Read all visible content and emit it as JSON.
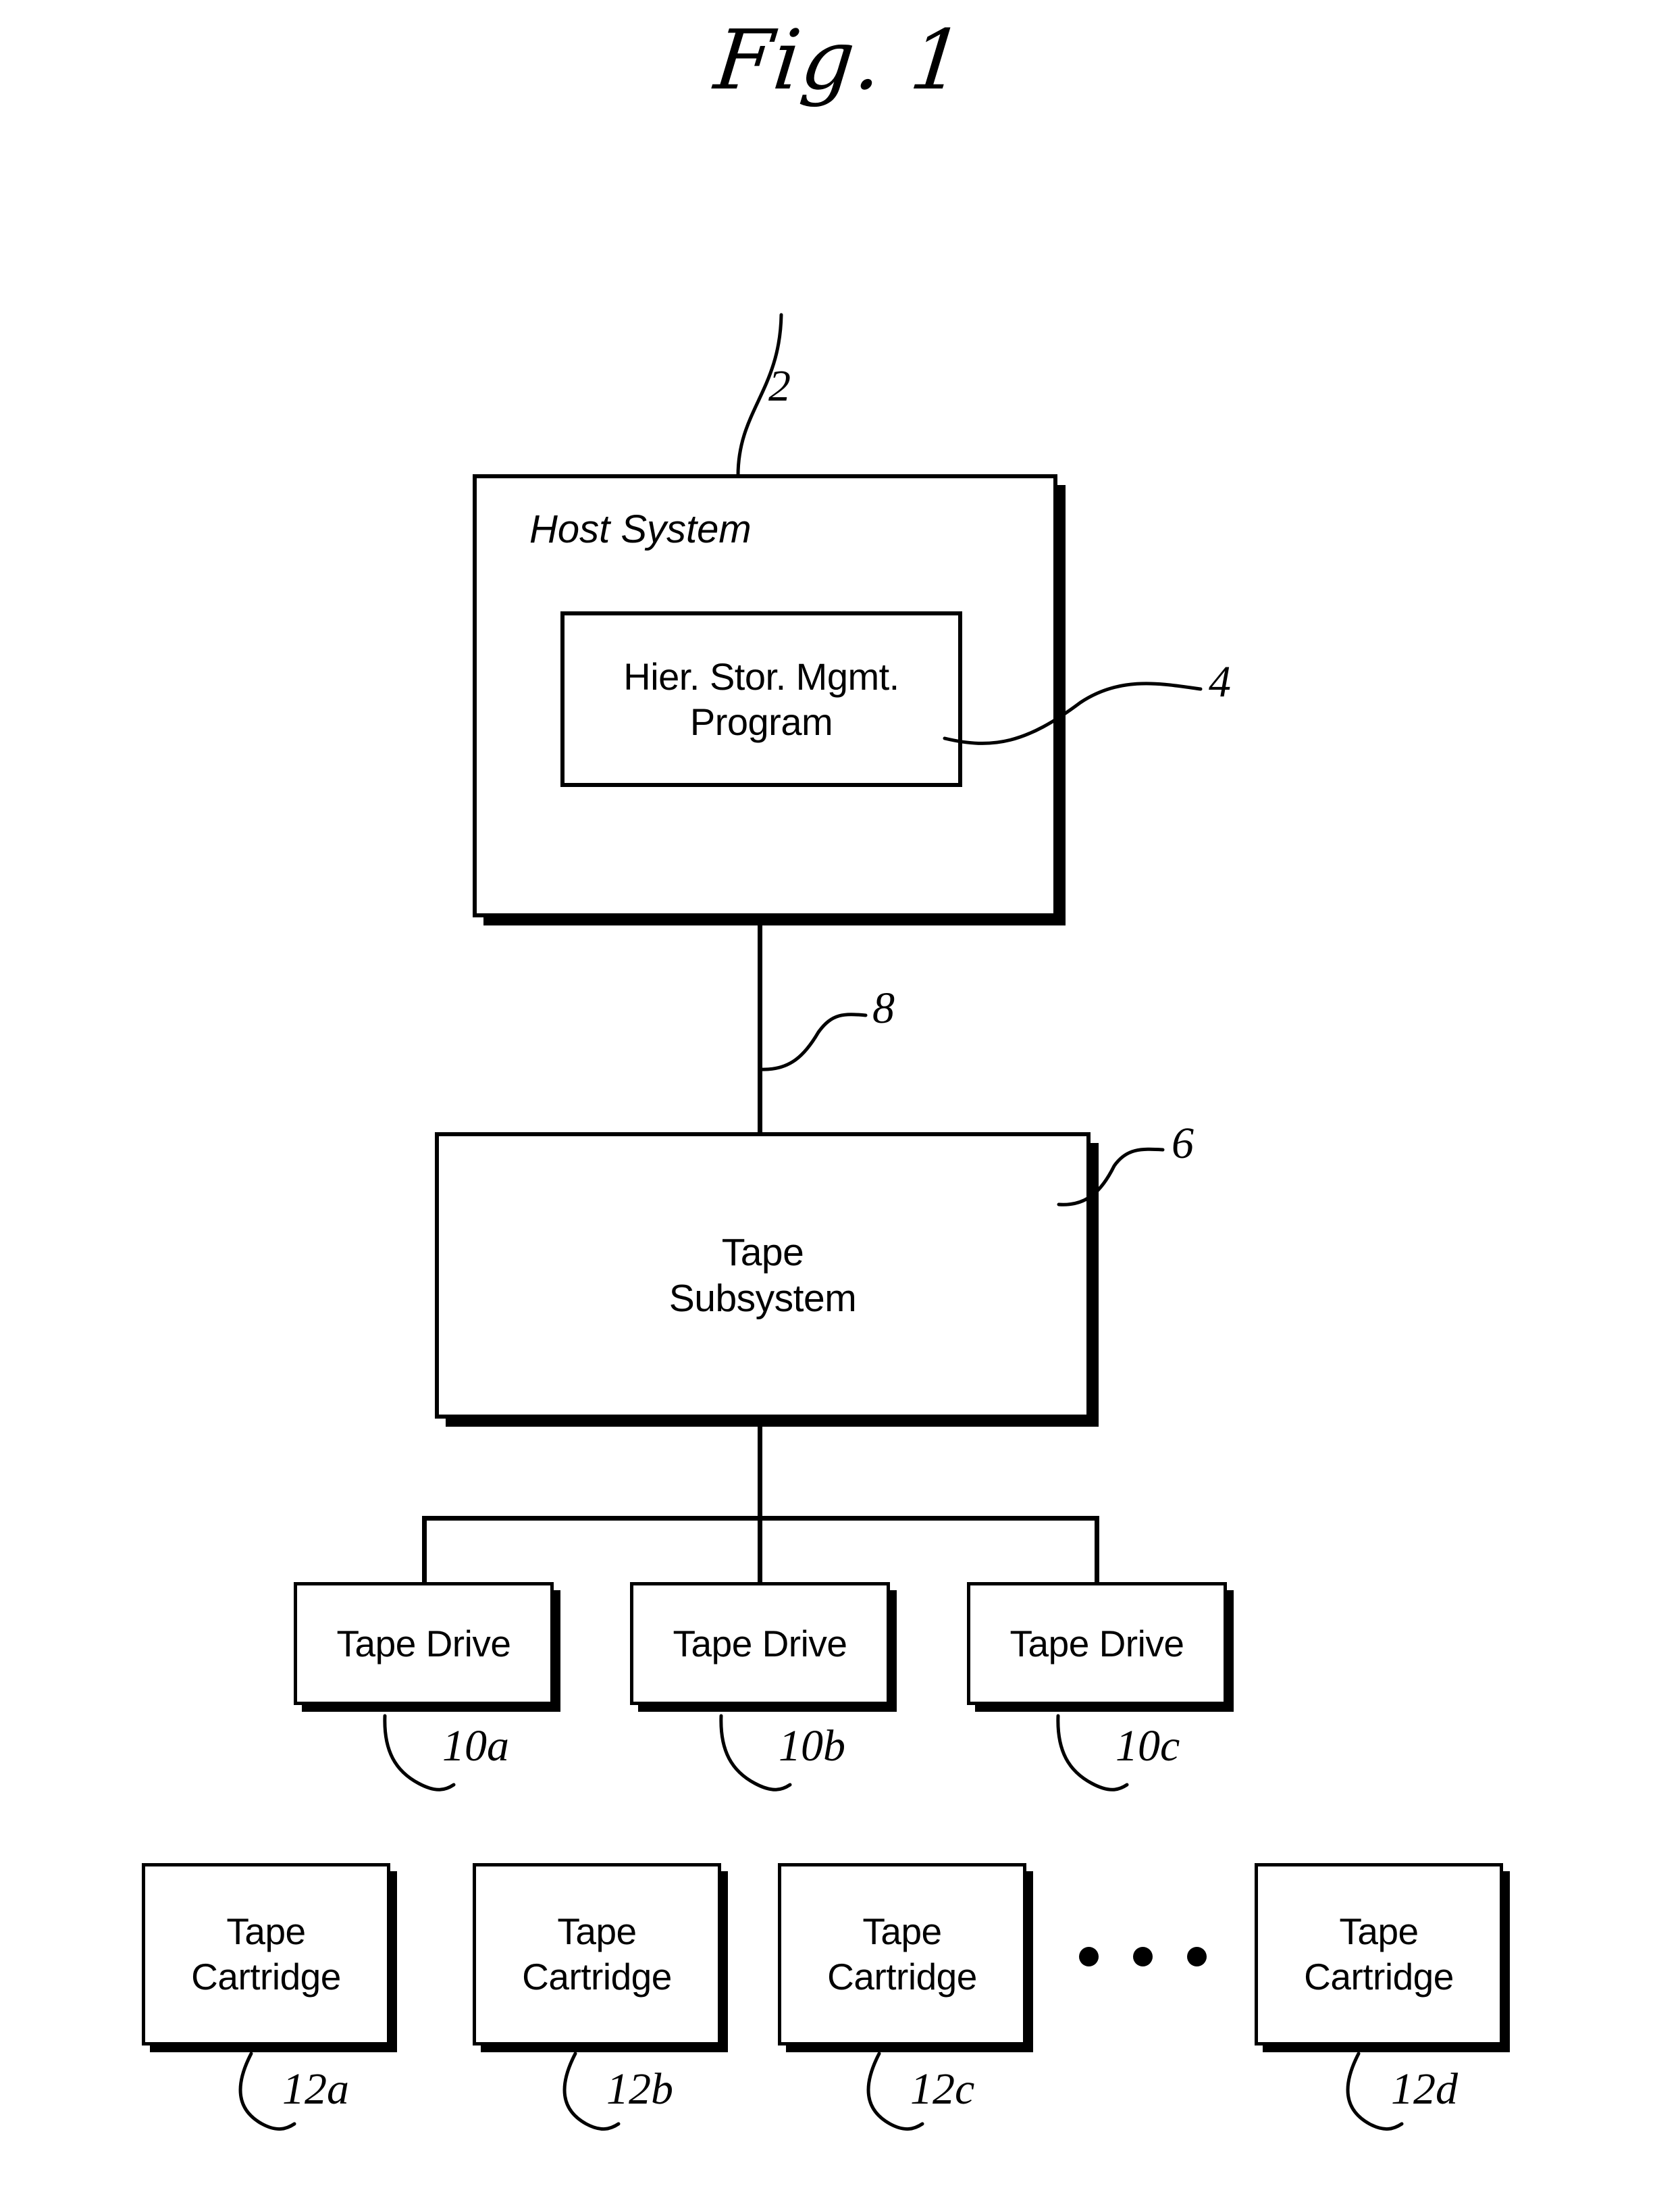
{
  "figure": {
    "title": "Fig. 1"
  },
  "host": {
    "title": "Host System",
    "ref": "2",
    "program": {
      "label": "Hier. Stor. Mgmt.\nProgram",
      "ref": "4"
    }
  },
  "subsystem": {
    "label": "Tape\nSubsystem",
    "ref": "6",
    "link_ref": "8"
  },
  "drives": [
    {
      "label": "Tape Drive",
      "ref": "10a"
    },
    {
      "label": "Tape Drive",
      "ref": "10b"
    },
    {
      "label": "Tape Drive",
      "ref": "10c"
    }
  ],
  "cartridges": [
    {
      "label": "Tape\nCartridge",
      "ref": "12a"
    },
    {
      "label": "Tape\nCartridge",
      "ref": "12b"
    },
    {
      "label": "Tape\nCartridge",
      "ref": "12c"
    },
    {
      "label": "Tape\nCartridge",
      "ref": "12d"
    }
  ],
  "ellipsis": {
    "dot_count": 3
  },
  "colors": {
    "ink": "#000000",
    "paper": "#ffffff"
  }
}
